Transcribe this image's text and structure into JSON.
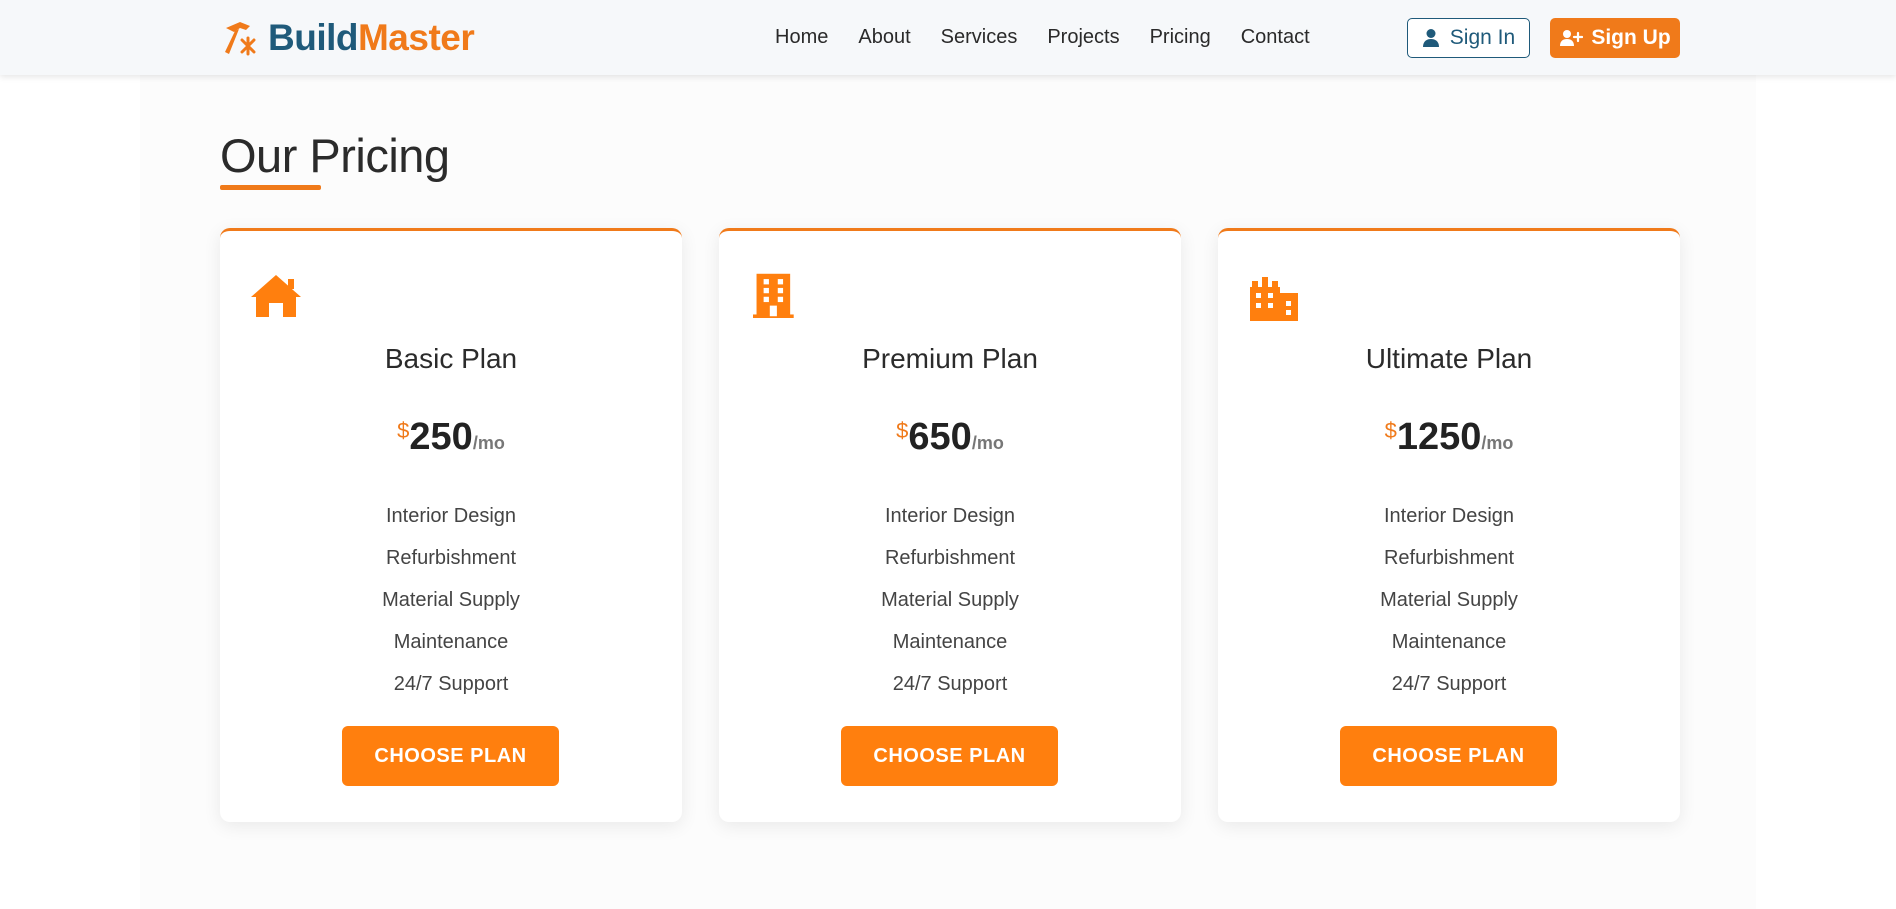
{
  "brand": {
    "part1": "Build",
    "part2": "Master",
    "icon": "hammer-icon"
  },
  "nav": {
    "items": [
      {
        "label": "Home"
      },
      {
        "label": "About"
      },
      {
        "label": "Services"
      },
      {
        "label": "Projects"
      },
      {
        "label": "Pricing"
      },
      {
        "label": "Contact"
      }
    ]
  },
  "auth": {
    "signin_label": "Sign In",
    "signin_icon": "user-icon",
    "signup_label": "Sign Up",
    "signup_icon": "user-plus-icon"
  },
  "pricing": {
    "title": "Our Pricing",
    "plans": [
      {
        "icon": "house-icon",
        "name": "Basic Plan",
        "currency": "$",
        "price": "250",
        "period": "/mo",
        "features": [
          "Interior Design",
          "Refurbishment",
          "Material Supply",
          "Maintenance",
          "24/7 Support"
        ],
        "button": "CHOOSE PLAN"
      },
      {
        "icon": "building-icon",
        "name": "Premium Plan",
        "currency": "$",
        "price": "650",
        "period": "/mo",
        "features": [
          "Interior Design",
          "Refurbishment",
          "Material Supply",
          "Maintenance",
          "24/7 Support"
        ],
        "button": "CHOOSE PLAN"
      },
      {
        "icon": "city-icon",
        "name": "Ultimate Plan",
        "currency": "$",
        "price": "1250",
        "period": "/mo",
        "features": [
          "Interior Design",
          "Refurbishment",
          "Material Supply",
          "Maintenance",
          "24/7 Support"
        ],
        "button": "CHOOSE PLAN"
      }
    ]
  },
  "colors": {
    "accent": "#f07a1a",
    "button": "#ff7f0e",
    "brand_dark": "#1f5a7a",
    "text": "#2b2b2b"
  }
}
